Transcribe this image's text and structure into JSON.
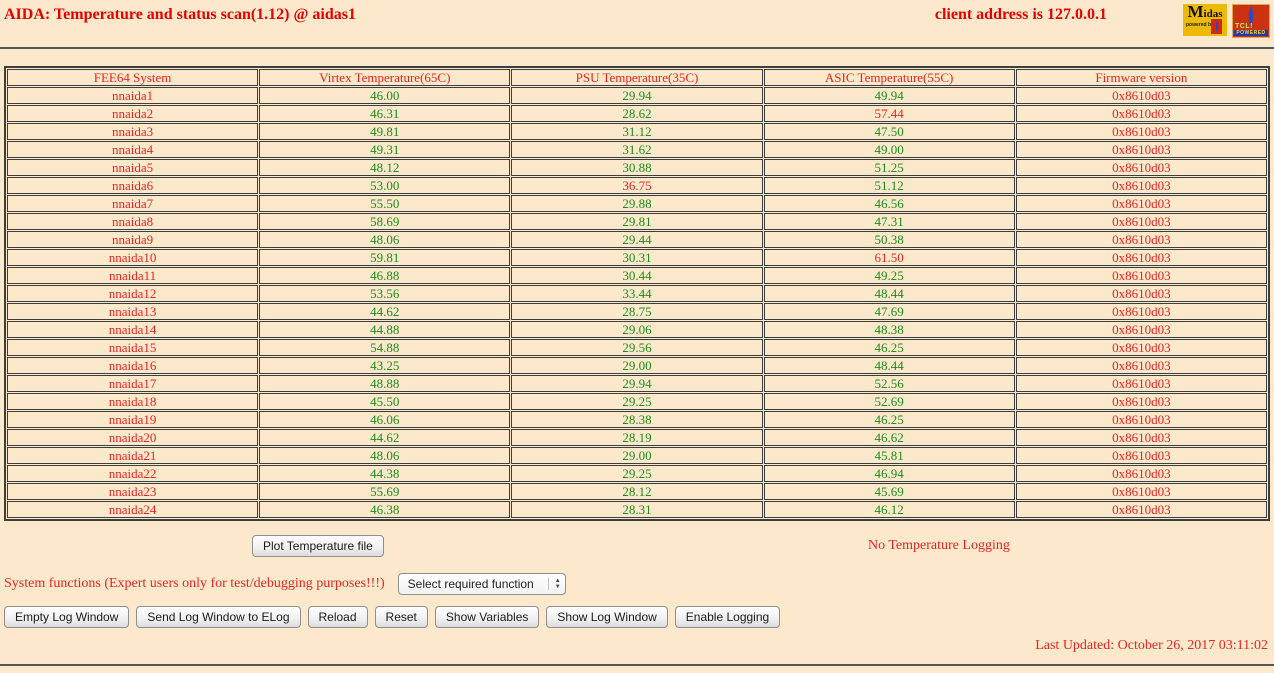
{
  "colors": {
    "page_bg": "#fce9cc",
    "alert_red": "#e82525",
    "title_red": "#e60000",
    "ok_green": "#1e8c1e",
    "border_dark": "#3e3e3e"
  },
  "header": {
    "title": "AIDA: Temperature and status scan(1.12) @ aidas1",
    "client_address": "client address is 127.0.0.1",
    "midas_logo": {
      "label": "Midas",
      "sub": "powered by"
    },
    "tcl_logo": {
      "label": "TCL!",
      "sub": "POWERED"
    }
  },
  "table": {
    "columns": [
      "FEE64 System",
      "Virtex Temperature(65C)",
      "PSU Temperature(35C)",
      "ASIC Temperature(55C)",
      "Firmware version"
    ],
    "rows": [
      {
        "name": "nnaida1",
        "virtex": "46.00",
        "psu": "29.94",
        "asic": "49.94",
        "firmware": "0x8610d03",
        "alarms": []
      },
      {
        "name": "nnaida2",
        "virtex": "46.31",
        "psu": "28.62",
        "asic": "57.44",
        "firmware": "0x8610d03",
        "alarms": [
          "asic"
        ]
      },
      {
        "name": "nnaida3",
        "virtex": "49.81",
        "psu": "31.12",
        "asic": "47.50",
        "firmware": "0x8610d03",
        "alarms": []
      },
      {
        "name": "nnaida4",
        "virtex": "49.31",
        "psu": "31.62",
        "asic": "49.00",
        "firmware": "0x8610d03",
        "alarms": []
      },
      {
        "name": "nnaida5",
        "virtex": "48.12",
        "psu": "30.88",
        "asic": "51.25",
        "firmware": "0x8610d03",
        "alarms": []
      },
      {
        "name": "nnaida6",
        "virtex": "53.00",
        "psu": "36.75",
        "asic": "51.12",
        "firmware": "0x8610d03",
        "alarms": [
          "psu"
        ]
      },
      {
        "name": "nnaida7",
        "virtex": "55.50",
        "psu": "29.88",
        "asic": "46.56",
        "firmware": "0x8610d03",
        "alarms": []
      },
      {
        "name": "nnaida8",
        "virtex": "58.69",
        "psu": "29.81",
        "asic": "47.31",
        "firmware": "0x8610d03",
        "alarms": []
      },
      {
        "name": "nnaida9",
        "virtex": "48.06",
        "psu": "29.44",
        "asic": "50.38",
        "firmware": "0x8610d03",
        "alarms": []
      },
      {
        "name": "nnaida10",
        "virtex": "59.81",
        "psu": "30.31",
        "asic": "61.50",
        "firmware": "0x8610d03",
        "alarms": [
          "asic"
        ]
      },
      {
        "name": "nnaida11",
        "virtex": "46.88",
        "psu": "30.44",
        "asic": "49.25",
        "firmware": "0x8610d03",
        "alarms": []
      },
      {
        "name": "nnaida12",
        "virtex": "53.56",
        "psu": "33.44",
        "asic": "48.44",
        "firmware": "0x8610d03",
        "alarms": []
      },
      {
        "name": "nnaida13",
        "virtex": "44.62",
        "psu": "28.75",
        "asic": "47.69",
        "firmware": "0x8610d03",
        "alarms": []
      },
      {
        "name": "nnaida14",
        "virtex": "44.88",
        "psu": "29.06",
        "asic": "48.38",
        "firmware": "0x8610d03",
        "alarms": []
      },
      {
        "name": "nnaida15",
        "virtex": "54.88",
        "psu": "29.56",
        "asic": "46.25",
        "firmware": "0x8610d03",
        "alarms": []
      },
      {
        "name": "nnaida16",
        "virtex": "43.25",
        "psu": "29.00",
        "asic": "48.44",
        "firmware": "0x8610d03",
        "alarms": []
      },
      {
        "name": "nnaida17",
        "virtex": "48.88",
        "psu": "29.94",
        "asic": "52.56",
        "firmware": "0x8610d03",
        "alarms": []
      },
      {
        "name": "nnaida18",
        "virtex": "45.50",
        "psu": "29.25",
        "asic": "52.69",
        "firmware": "0x8610d03",
        "alarms": []
      },
      {
        "name": "nnaida19",
        "virtex": "46.06",
        "psu": "28.38",
        "asic": "46.25",
        "firmware": "0x8610d03",
        "alarms": []
      },
      {
        "name": "nnaida20",
        "virtex": "44.62",
        "psu": "28.19",
        "asic": "46.62",
        "firmware": "0x8610d03",
        "alarms": []
      },
      {
        "name": "nnaida21",
        "virtex": "48.06",
        "psu": "29.00",
        "asic": "45.81",
        "firmware": "0x8610d03",
        "alarms": []
      },
      {
        "name": "nnaida22",
        "virtex": "44.38",
        "psu": "29.25",
        "asic": "46.94",
        "firmware": "0x8610d03",
        "alarms": []
      },
      {
        "name": "nnaida23",
        "virtex": "55.69",
        "psu": "28.12",
        "asic": "45.69",
        "firmware": "0x8610d03",
        "alarms": []
      },
      {
        "name": "nnaida24",
        "virtex": "46.38",
        "psu": "28.31",
        "asic": "46.12",
        "firmware": "0x8610d03",
        "alarms": []
      }
    ]
  },
  "actions": {
    "plot_button": "Plot Temperature file",
    "logging_status": "No Temperature Logging",
    "system_functions_label": "System functions (Expert users only for test/debugging purposes!!!)",
    "function_select_value": "Select required function",
    "buttons": [
      "Empty Log Window",
      "Send Log Window to ELog",
      "Reload",
      "Reset",
      "Show Variables",
      "Show Log Window",
      "Enable Logging"
    ]
  },
  "footer": {
    "last_updated": "Last Updated: October 26, 2017 03:11:02"
  }
}
